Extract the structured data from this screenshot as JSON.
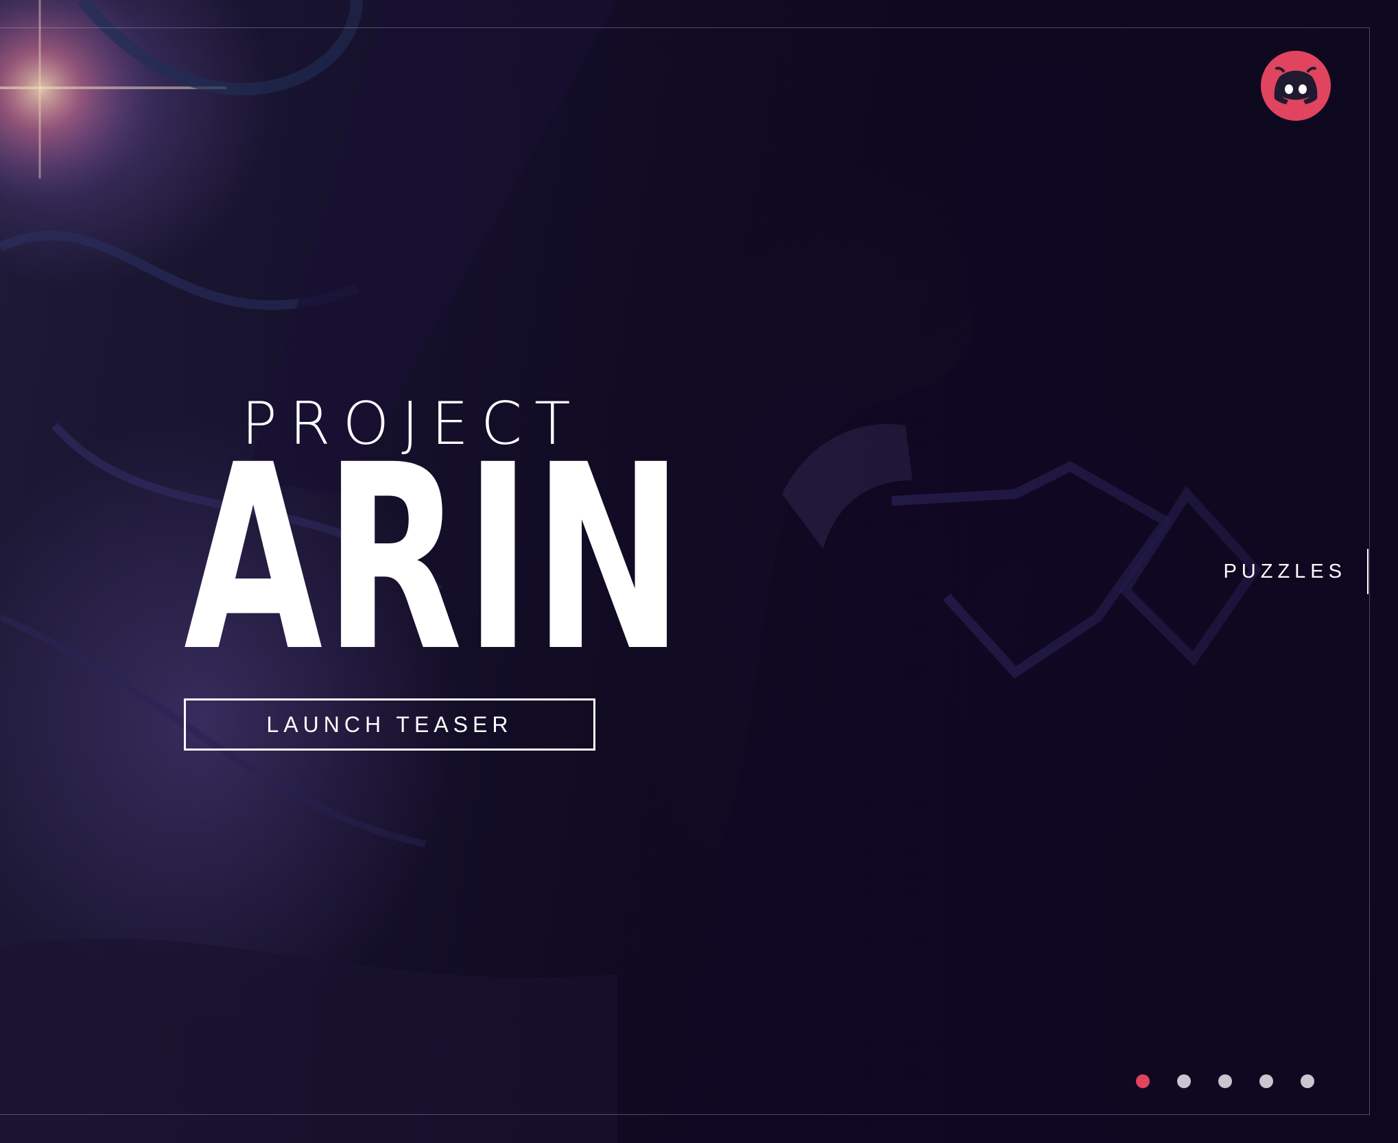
{
  "hero": {
    "title_small": "PROJECT",
    "title_big": "ARIN",
    "cta_label": "LAUNCH TEASER"
  },
  "nav": {
    "side_label": "PUZZLES"
  },
  "social": {
    "icon": "discord-icon",
    "color": "#e0445f"
  },
  "pagination": {
    "total": 5,
    "active_index": 0,
    "active_color": "#e0445f",
    "inactive_color": "#c9c6cf"
  }
}
